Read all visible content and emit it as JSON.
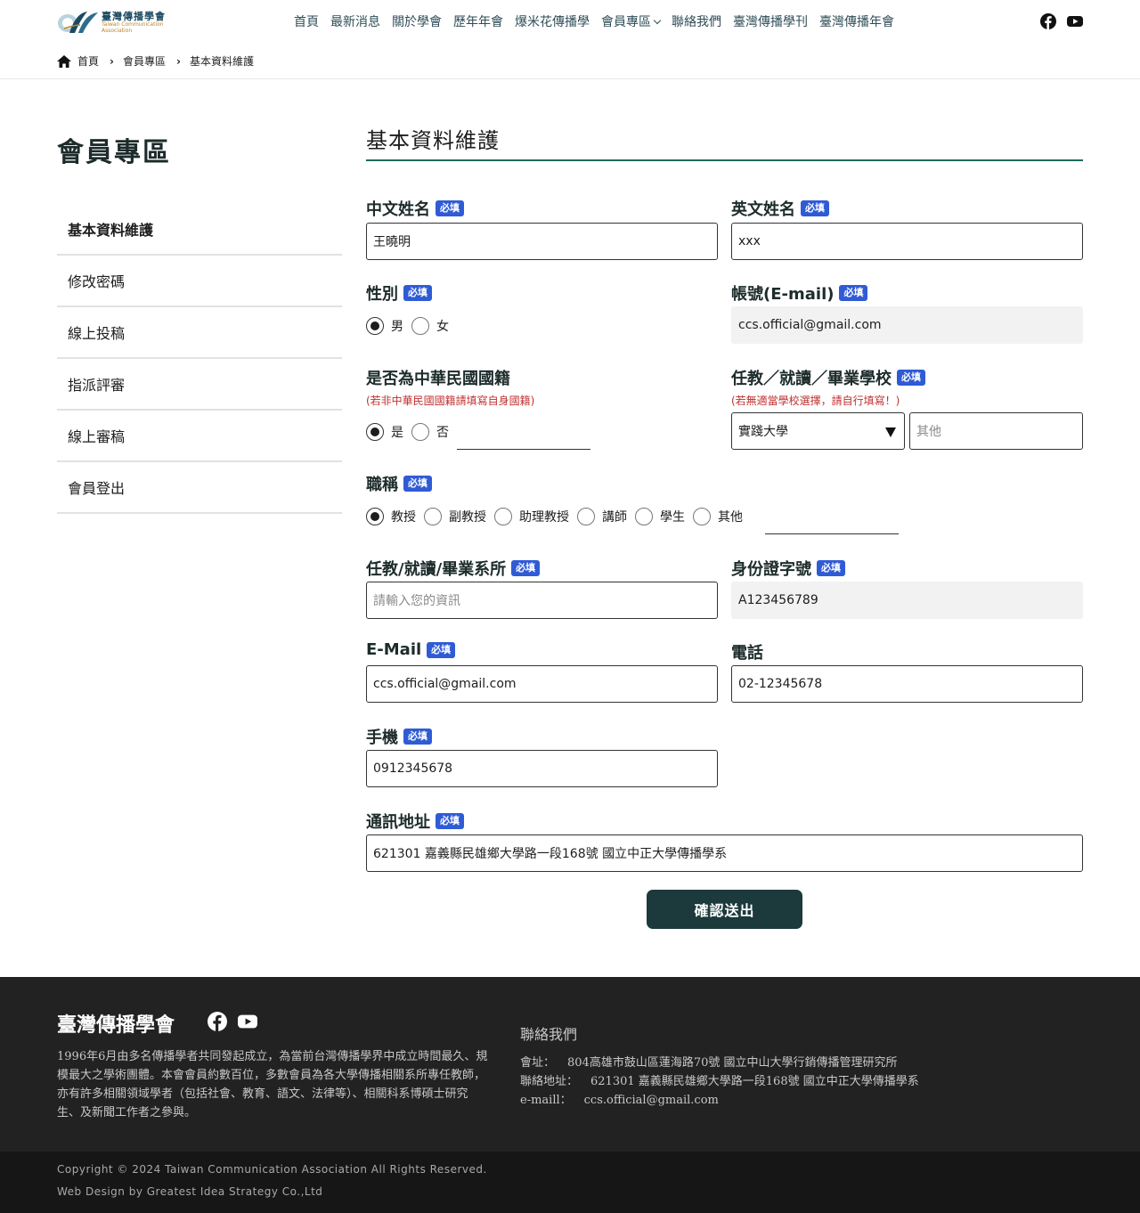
{
  "header": {
    "logo_zh": "臺灣傳播學會",
    "logo_en": "Taiwan Communication\nAssociation",
    "nav": [
      "首頁",
      "最新消息",
      "關於學會",
      "歷年年會",
      "爆米花傳播學",
      "會員專區",
      "聯絡我們",
      "臺灣傳播學刊",
      "臺灣傳播年會"
    ],
    "social_icons": [
      "facebook-icon",
      "youtube-icon"
    ]
  },
  "breadcrumb": [
    "首頁",
    "會員專區",
    "基本資料維護"
  ],
  "sidebar": {
    "title": "會員專區",
    "items": [
      "基本資料維護",
      "修改密碼",
      "線上投稿",
      "指派評審",
      "線上審稿",
      "會員登出"
    ]
  },
  "form": {
    "title": "基本資料維護",
    "required_badge": "必填",
    "chinese_name": {
      "label": "中文姓名",
      "value": "王曉明"
    },
    "english_name": {
      "label": "英文姓名",
      "value": "xxx"
    },
    "gender": {
      "label": "性別",
      "options": [
        "男",
        "女"
      ],
      "selected": "男"
    },
    "account": {
      "label": "帳號(E-mail)",
      "value": "ccs.official@gmail.com"
    },
    "nationality": {
      "label": "是否為中華民國國籍",
      "hint": "(若非中華民國國籍請填寫自身國籍)",
      "options": [
        "是",
        "否"
      ],
      "selected": "是"
    },
    "school": {
      "label": "任教／就讀／畢業學校",
      "hint": "(若無適當學校選擇，請自行填寫！)",
      "selected": "實踐大學",
      "other_placeholder": "其他"
    },
    "title_field": {
      "label": "職稱",
      "options": [
        "教授",
        "副教授",
        "助理教授",
        "講師",
        "學生",
        "其他"
      ],
      "selected": "教授"
    },
    "department": {
      "label": "任教/就讀/畢業系所",
      "placeholder": "請輸入您的資訊"
    },
    "id_number": {
      "label": "身份證字號",
      "value": "A123456789"
    },
    "email": {
      "label": "E-Mail",
      "value": "ccs.official@gmail.com"
    },
    "phone": {
      "label": "電話",
      "value": "02-12345678"
    },
    "mobile": {
      "label": "手機",
      "value": "0912345678"
    },
    "address": {
      "label": "通訊地址",
      "value": "621301 嘉義縣民雄鄉大學路一段168號 國立中正大學傳播學系"
    },
    "submit_label": "確認送出"
  },
  "footer": {
    "name": "臺灣傳播學會",
    "description": "1996年6月由多名傳播學者共同發起成立，為當前台灣傳播學界中成立時間最久、規模最大之學術團體。本會會員約數百位，多數會員為各大學傳播相關系所專任教師，亦有許多相關領域學者（包括社會、教育、語文、法律等）、相關科系博碩士研究生、及新聞工作者之參與。",
    "contact_title": "聯絡我們",
    "contact": [
      {
        "key": "會址：",
        "value": "804高雄市鼓山區蓮海路70號 國立中山大學行銷傳播管理研究所"
      },
      {
        "key": "聯絡地址：",
        "value": "621301 嘉義縣民雄鄉大學路一段168號 國立中正大學傳播學系"
      },
      {
        "key": "e-maill：",
        "value": "ccs.official@gmail.com"
      }
    ],
    "copyright": "Copyright © 2024 Taiwan Communication Association All Rights Reserved.",
    "credit": "Web Design by Greatest Idea Strategy Co.,Ltd"
  }
}
